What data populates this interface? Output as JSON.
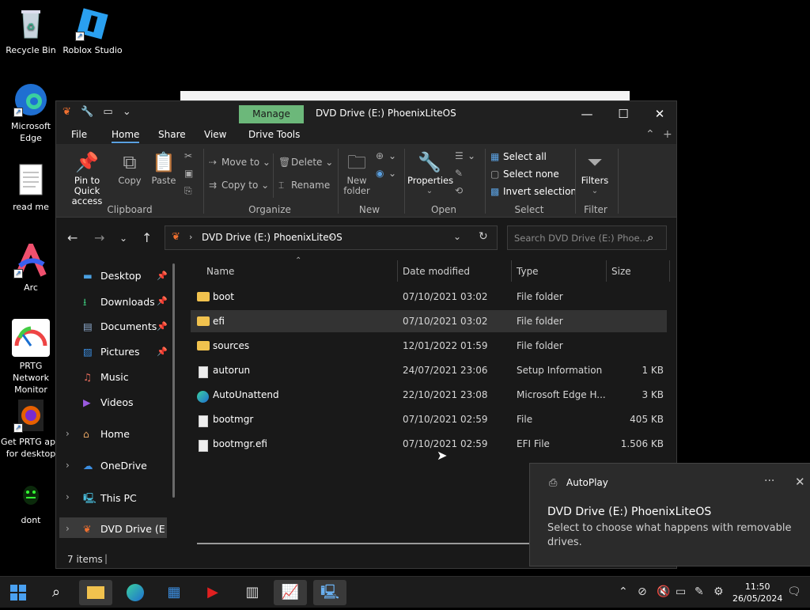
{
  "desktop": {
    "icons": [
      {
        "label": "Recycle Bin"
      },
      {
        "label": "Roblox Studio"
      },
      {
        "label": "Microsoft Edge"
      },
      {
        "label": "read me"
      },
      {
        "label": "Arc"
      },
      {
        "label": "PRTG Network Monitor"
      },
      {
        "label": "Get PRTG app for desktop"
      },
      {
        "label": "dont"
      }
    ]
  },
  "window": {
    "title": "DVD Drive (E:) PhoenixLiteOS",
    "context_tab": "Manage",
    "tabs": [
      "File",
      "Home",
      "Share",
      "View",
      "Drive Tools"
    ],
    "active_tab": "Home"
  },
  "ribbon": {
    "clipboard": {
      "pin": "Pin to Quick access",
      "copy": "Copy",
      "paste": "Paste",
      "label": "Clipboard"
    },
    "organize": {
      "move_to": "Move to",
      "copy_to": "Copy to",
      "delete": "Delete",
      "rename": "Rename",
      "label": "Organize"
    },
    "new": {
      "new_folder": "New folder",
      "label": "New"
    },
    "open": {
      "properties": "Properties",
      "label": "Open"
    },
    "select": {
      "select_all": "Select all",
      "select_none": "Select none",
      "invert": "Invert selection",
      "label": "Select"
    },
    "filter": {
      "filters": "Filters",
      "label": "Filter"
    }
  },
  "address": {
    "path": "DVD Drive (E:) PhoenixLiteOS",
    "search_placeholder": "Search DVD Drive (E:) Phoe..."
  },
  "navpane": {
    "quick": [
      {
        "label": "Desktop",
        "pinned": true
      },
      {
        "label": "Downloads",
        "pinned": true
      },
      {
        "label": "Documents",
        "pinned": true
      },
      {
        "label": "Pictures",
        "pinned": true
      },
      {
        "label": "Music",
        "pinned": false
      },
      {
        "label": "Videos",
        "pinned": false
      }
    ],
    "roots": [
      {
        "label": "Home"
      },
      {
        "label": "OneDrive"
      },
      {
        "label": "This PC"
      },
      {
        "label": "DVD Drive (E:) Ph"
      }
    ]
  },
  "filelist": {
    "columns": [
      "Name",
      "Date modified",
      "Type",
      "Size"
    ],
    "rows": [
      {
        "name": "boot",
        "date": "07/10/2021 03:02",
        "type": "File folder",
        "size": "",
        "icon": "folder-icon"
      },
      {
        "name": "efi",
        "date": "07/10/2021 03:02",
        "type": "File folder",
        "size": "",
        "icon": "folder-icon"
      },
      {
        "name": "sources",
        "date": "12/01/2022 01:59",
        "type": "File folder",
        "size": "",
        "icon": "folder-icon"
      },
      {
        "name": "autorun",
        "date": "24/07/2021 23:06",
        "type": "Setup Information",
        "size": "1 KB",
        "icon": "setup-file-icon"
      },
      {
        "name": "AutoUnattend",
        "date": "22/10/2021 23:08",
        "type": "Microsoft Edge H...",
        "size": "3 KB",
        "icon": "edge-icon"
      },
      {
        "name": "bootmgr",
        "date": "07/10/2021 02:59",
        "type": "File",
        "size": "405 KB",
        "icon": "file-icon"
      },
      {
        "name": "bootmgr.efi",
        "date": "07/10/2021 02:59",
        "type": "EFI File",
        "size": "1.506 KB",
        "icon": "file-icon"
      }
    ]
  },
  "status": {
    "items": "7 items"
  },
  "toast": {
    "app": "AutoPlay",
    "title": "DVD Drive (E:) PhoenixLiteOS",
    "body": "Select to choose what happens with removable drives."
  },
  "taskbar": {
    "time": "11:50",
    "date": "26/05/2024"
  }
}
